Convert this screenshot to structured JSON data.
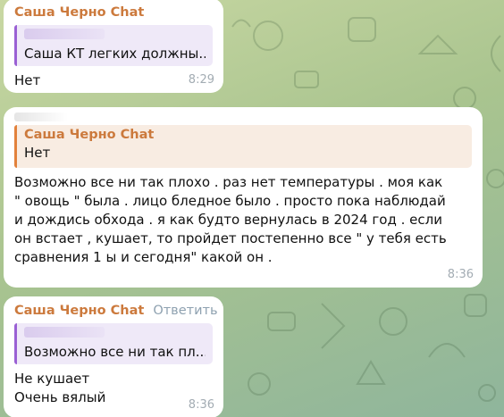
{
  "colors": {
    "sender": "#cc7a3d",
    "quote_bar_purple": "#9a60d4",
    "quote_bar_orange": "#e2813b",
    "time": "#a3acb3",
    "reply_action": "#8ea1b0"
  },
  "messages": [
    {
      "sender": "Саша Черно Chat",
      "quote_text": "Саша КТ легких должны...",
      "text": "Нет",
      "time": "8:29"
    },
    {
      "quote_sender": "Саша Черно Chat",
      "quote_text": "Нет",
      "text": "Возможно все ни так плохо . раз нет температуры . моя как \" овощь \" была . лицо бледное было . просто пока наблюдай и дождись обхода . я как будто вернулась в 2024 год . если он встает , кушает, то пройдет постепенно все \" у тебя есть сравнения 1 ы и сегодня\" какой он .",
      "time": "8:36"
    },
    {
      "sender": "Саша Черно Chat",
      "reply_label": "Ответить",
      "quote_text": "Возможно все ни так пл...",
      "text_line1": "Не кушает",
      "text_line2": "Очень вялый",
      "time": "8:36"
    }
  ]
}
